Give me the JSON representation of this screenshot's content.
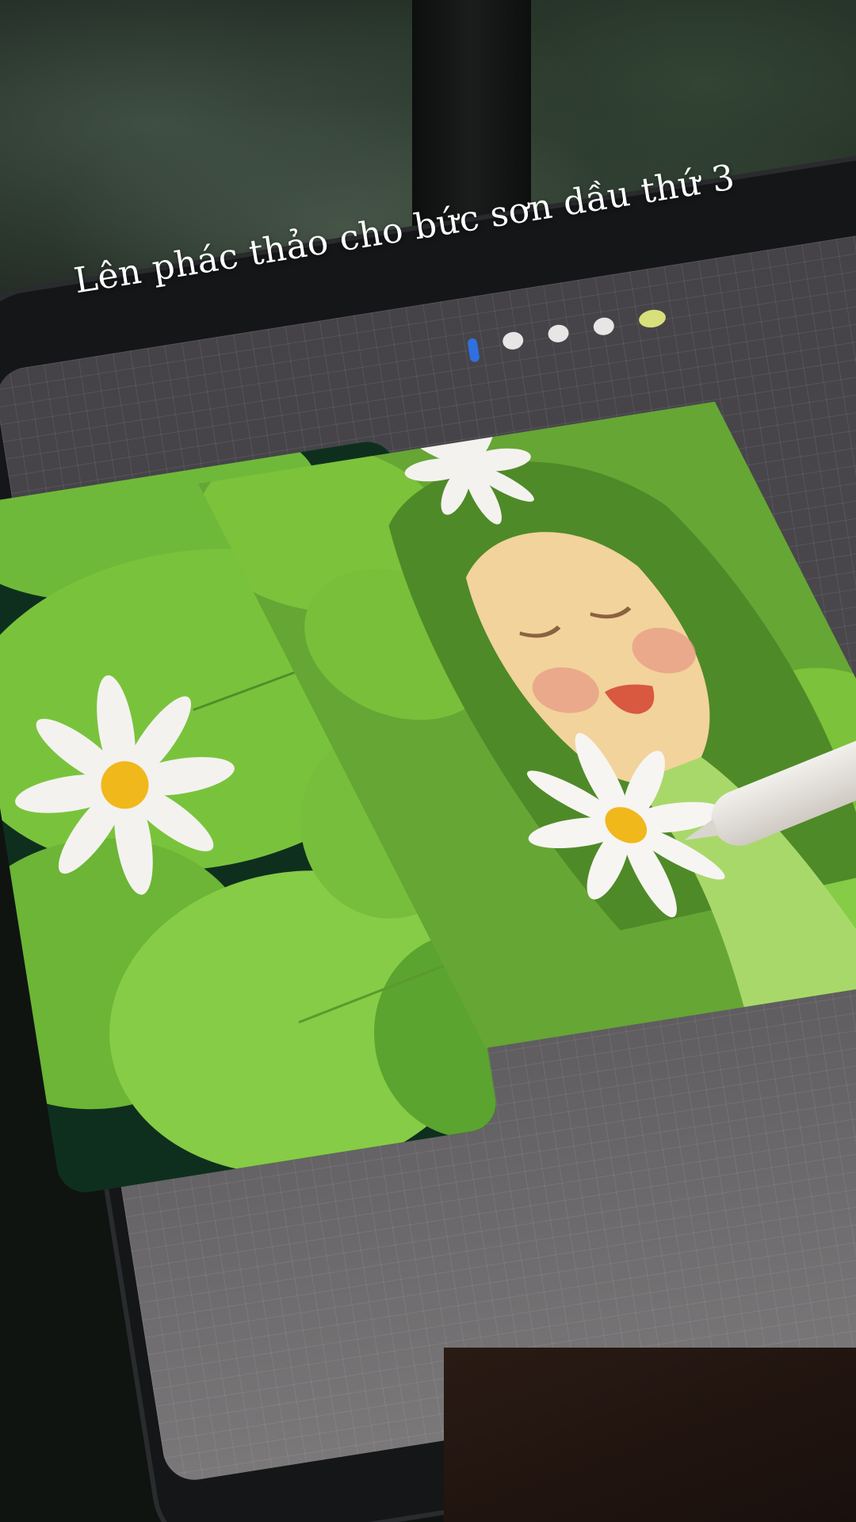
{
  "caption": {
    "text": "Lên phác thảo cho bức sơn dầu thứ 3"
  },
  "colors": {
    "screen_grid": "#6b696b",
    "painting_green": "#6fae38",
    "lily_pad_green": "#7cc23a",
    "flower_white": "#f4f2ef",
    "flower_center": "#f1b81c",
    "skin": "#f2d39b",
    "lips": "#d8593f",
    "cheek": "#e79b86"
  },
  "toolbar": {
    "icons": [
      "pen-icon",
      "brush-icon",
      "eraser-icon",
      "layers-icon",
      "color-icon"
    ]
  }
}
